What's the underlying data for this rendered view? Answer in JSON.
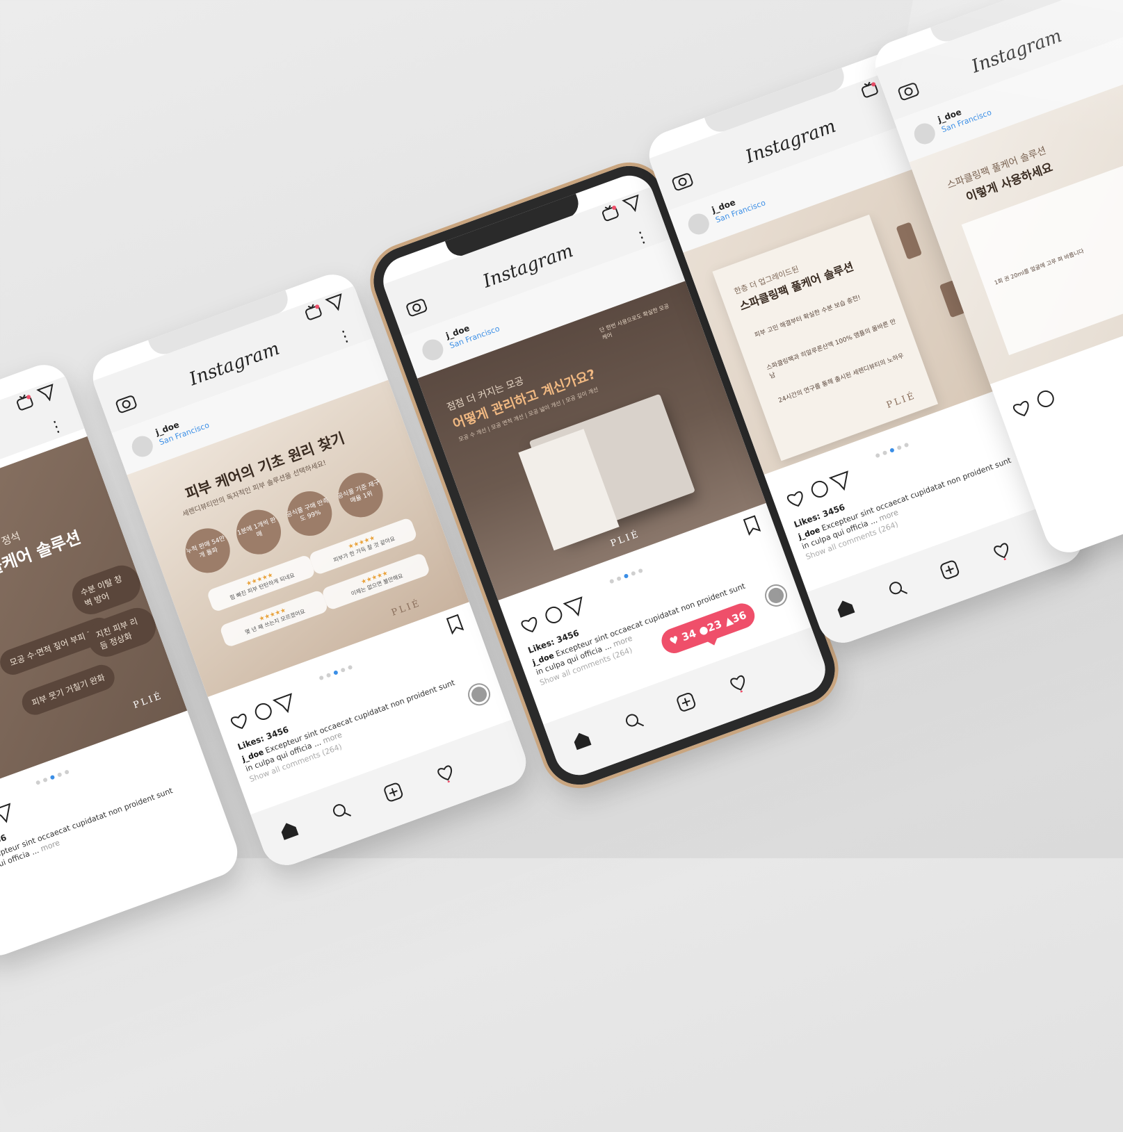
{
  "app": {
    "logo_text": "Instagram",
    "user": "j_doe",
    "location": "San Francisco",
    "likes": "Likes: 3456",
    "caption_user": "j_doe",
    "caption_text_1": "Excepteur sint occaecat cupidatat non proident sunt",
    "caption_text_2": "in culpa qui officia ...",
    "caption_more": "more",
    "show_all": "Show all comments (264)"
  },
  "notification": {
    "hearts": "34",
    "comments": "23",
    "followers": "36"
  },
  "posts": {
    "p1": {
      "line1": "이의 정석",
      "line2": "풀케어 솔루션",
      "pill1": "수분 이탈 창벽 방어",
      "pill2": "모공 수·면적 짚어 부피 개선",
      "pill3": "지친 피부 리듬 정상화",
      "pill4": "피부 뭇기 거칠기 완화",
      "brand": "PLIÉ"
    },
    "p2": {
      "title": "피부 케어의 기초 원리 찾기",
      "subtitle": "세렌디뷰티만의 독자적인 피부 솔루션을 선택하세요!",
      "c1": "누적 판매 54만개 돌파",
      "c2": "1분에 1개씩 판매",
      "c3": "공식몰 구매 만족도 99%",
      "c4": "공식몰 기준 재구매율 1위",
      "r1": "힘 빠진 피부 탄탄하게 되네요",
      "r2": "피부가 한 가득 찰 것 같아요",
      "r3": "이제는 없으면 불안해요",
      "r4": "몇 년 째 쓰는지 모르겠어요",
      "brand": "PLIÉ"
    },
    "p3": {
      "kicker": "점점 더 커지는 모공",
      "title": "어떻게 관리하고 계신가요?",
      "tags": "모공 수 개선 | 모공 면적 개선 | 모공 넓이 개선 | 모공 깊이 개선",
      "side": "단 한번 사용으로도 확실한 모공케어",
      "brand": "PLIÉ"
    },
    "p4": {
      "kicker": "한층 더 업그레이드된",
      "title": "스파클링팩 풀케어 솔루션",
      "s1": "피부 고민 해결부터 확실한 수분 보습 충전!",
      "s2": "스파클링팩과 히알루론산액 100% 앰플의 올바른 만남",
      "s3": "24시간의 연구를 통해 출시된 세렌디뷰티의 노하우",
      "brand": "PLIÉ"
    },
    "p5": {
      "kicker": "스파클링팩 풀케어 솔루션",
      "title": "이렇게 사용하세요",
      "steps": "1회 권 20ml를 얼굴에 고루 펴 바릅니다"
    }
  },
  "colors": {
    "accent_pink": "#ef4f6a",
    "link_blue": "#3a8ee6",
    "gold_frame": "#c9a57f",
    "brown_bg": "#5a463b"
  },
  "icons": [
    "camera-icon",
    "igtv-icon",
    "send-icon",
    "more-icon",
    "heart-icon",
    "comment-icon",
    "bookmark-icon",
    "home-icon",
    "search-icon",
    "add-icon",
    "activity-icon"
  ]
}
